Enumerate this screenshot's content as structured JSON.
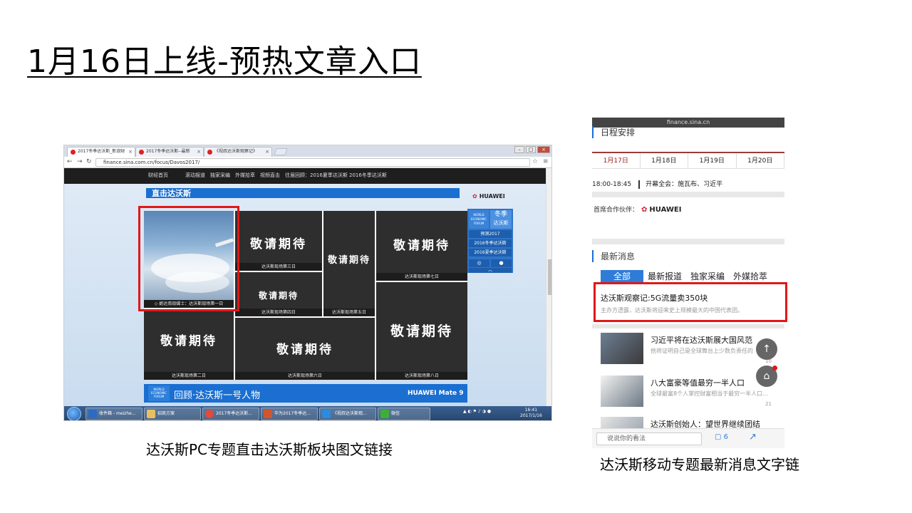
{
  "slide": {
    "title": "1月16日上线-预热文章入口",
    "caption_pc": "达沃斯PC专题直击达沃斯板块图文链接",
    "caption_mobile": "达沃斯移动专题最新消息文字链"
  },
  "pc": {
    "tabs": [
      "2017冬季达沃斯_新浪财",
      "2017冬季达沃斯--最新",
      "《视叔达沃斯观察记》"
    ],
    "url": "finance.sina.com.cn/focus/Davos2017/",
    "site_nav": [
      "财经首页",
      "滚动报道",
      "独家采编",
      "外媒拾萃",
      "视频直击",
      "往届回顾：2016夏季达沃斯",
      "2016冬季达沃斯"
    ],
    "section_title": "直击达沃斯",
    "huawei": "HUAWEI",
    "placeholder_text": "敬请期待",
    "cells": {
      "photo_caption": "◇ 妮达南现媒士：达沃斯现场第一日",
      "day2": "达沃斯现场第二日",
      "day3": "达沃斯现场第三日",
      "day4": "达沃斯现场第四日",
      "day5": "达沃斯现场第五日",
      "day6": "达沃斯现场第六日",
      "day7": "达沃斯现场第七日",
      "day8": "达沃斯现场第八日"
    },
    "side_widget": {
      "logo": "WORLD ECONOMIC FORUM",
      "season": "冬季",
      "season_sub": "达沃斯",
      "links": [
        "预测2017",
        "2016冬季达沃斯",
        "2016夏季达沃斯"
      ],
      "up": "︿"
    },
    "review_bar": {
      "logo": "WORLD ECONOMIC FORUM",
      "title": "回顾·达沃斯一号人物",
      "brand": "HUAWEI Mate 9"
    },
    "taskbar": {
      "tasks": [
        "收件箱 - meizhe...",
        "招商方案",
        "2017冬季达沃斯...",
        "华为2017冬季达...",
        "《视叔达沃斯观...",
        "微信"
      ],
      "time": "16:41",
      "date": "2017/1/16"
    }
  },
  "mobile": {
    "domain": "finance.sina.cn",
    "schedule_title": "日程安排",
    "date_tabs": [
      "1月17日",
      "1月18日",
      "1月19日",
      "1月20日"
    ],
    "schedule_time": "18:00-18:45",
    "schedule_event": "开幕全会：施瓦布、习近平",
    "partner_label": "首席合作伙伴：",
    "partner_brand": "HUAWEI",
    "news_title": "最新消息",
    "news_tabs": [
      "全部",
      "最新报道",
      "独家采编",
      "外媒拾萃"
    ],
    "featured": {
      "headline": "达沃斯观察记:5G流量卖350块",
      "summary": "主办方透露，达沃斯将迎来史上规模最大的中国代表团。"
    },
    "items": [
      {
        "headline": "习近平将在达沃斯展大国风范",
        "summary": "他将证明自己是全球舞台上少数负责任的",
        "count": "10"
      },
      {
        "headline": "八大富豪等值最穷一半人口",
        "summary": "全球最富8个人掌控财富相当于最穷一半人口...",
        "count": "21"
      },
      {
        "headline": "达沃斯创始人：望世界继续团结",
        "summary": "",
        "count": ""
      }
    ],
    "comment_placeholder": "说说你的看法",
    "comment_count": "6",
    "fab_up": "↑",
    "fab_home": "⌂"
  }
}
